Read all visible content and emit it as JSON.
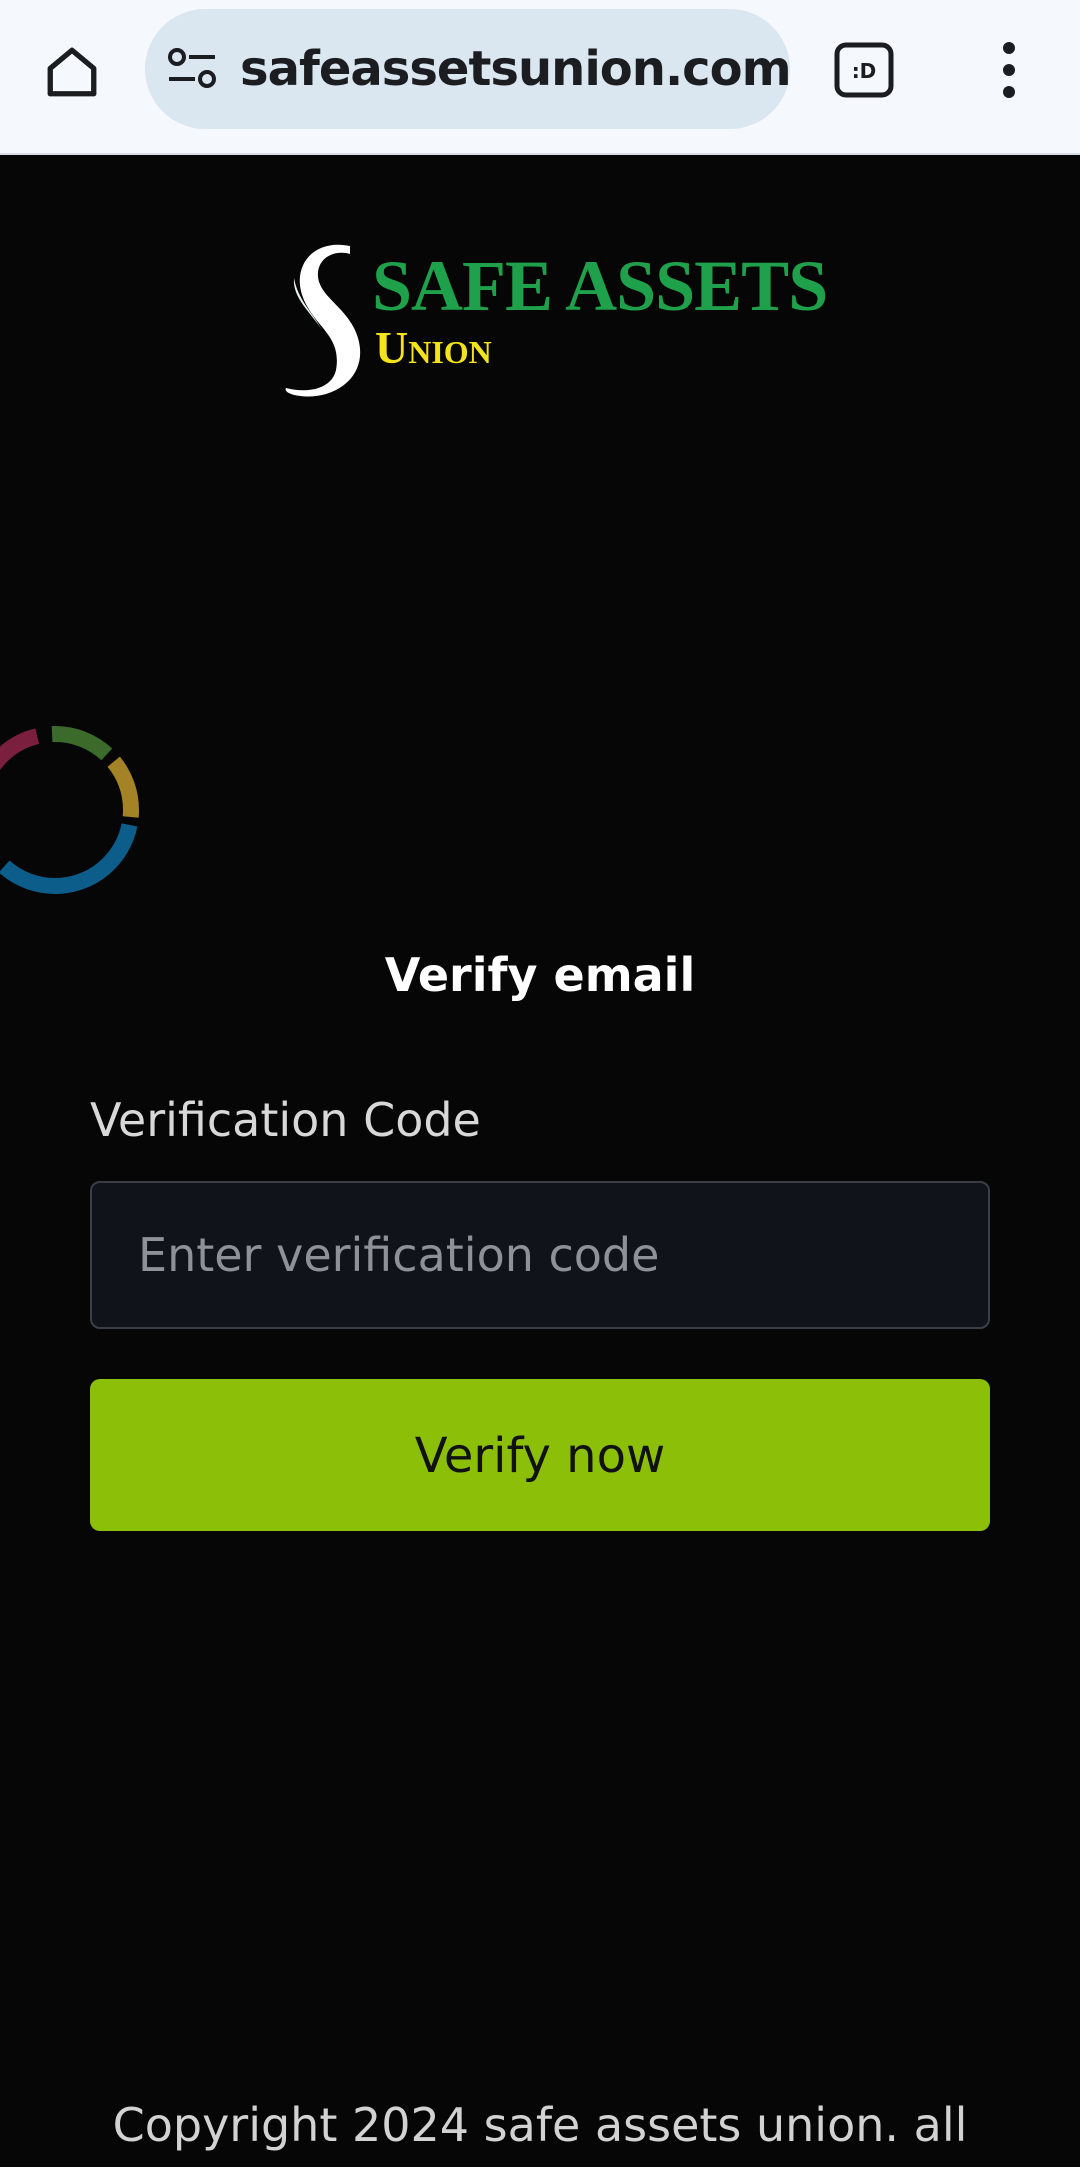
{
  "browser": {
    "url": "safeassetsunion.com/",
    "icons": [
      "home-icon",
      "site-settings-icon",
      "tab-switcher-icon",
      "more-menu-icon"
    ],
    "tab_label": ":D",
    "bar_color": "#f5f8fd"
  },
  "logo": {
    "title": "SAFE ASSETS",
    "subtitle": "Union",
    "title_color": "#1fa04a",
    "subtitle_color": "#f2e31a"
  },
  "form": {
    "heading": "Verify email",
    "field_label": "Verification Code",
    "field_value": "",
    "field_placeholder": "Enter verification code",
    "submit_label": "Verify now",
    "accent_color": "#8bbf08"
  },
  "footer": {
    "copyright": "Copyright 2024 safe assets union. all"
  },
  "colors": {
    "background": "#060606",
    "spinner": [
      "#7a1f3d",
      "#3b6a2a",
      "#a38326",
      "#0c5d8a"
    ]
  }
}
